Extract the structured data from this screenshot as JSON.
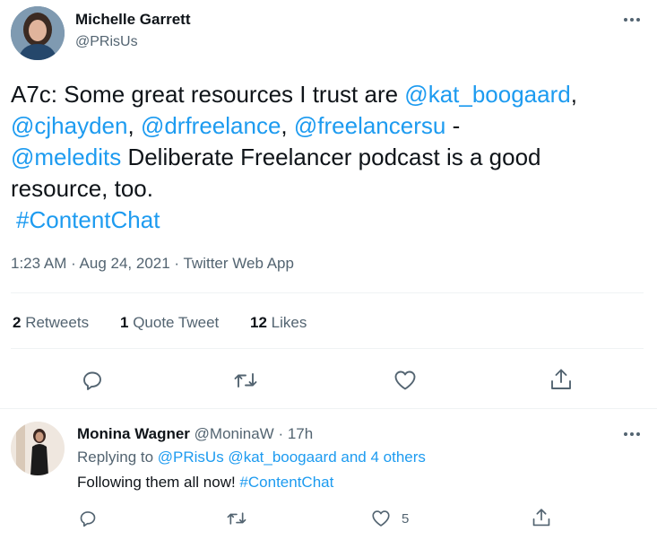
{
  "main_tweet": {
    "author_name": "Michelle Garrett",
    "author_handle": "@PRisUs",
    "text_intro": "A7c: Some great resources I trust are ",
    "mention_1": "@kat_boogaard",
    "sep_1": ",",
    "mention_2": "@cjhayden",
    "sep_2": ", ",
    "mention_3": "@drfreelance",
    "sep_3": ", ",
    "mention_4": "@freelancersu",
    "sep_4": " -",
    "mention_5": "@meledits",
    "text_body": " Deliberate Freelancer podcast is a good resource, too.",
    "hashtag": "#ContentChat",
    "timestamp": "1:23 AM · Aug 24, 2021 · Twitter Web App",
    "retweets_count": "2",
    "retweets_label": "Retweets",
    "quotes_count": "1",
    "quotes_label": "Quote Tweet",
    "likes_count": "12",
    "likes_label": "Likes",
    "more_icon": "more-horizontal-icon"
  },
  "reply_tweet": {
    "author_name": "Monina Wagner",
    "author_handle": "@MoninaW",
    "time_ago": "· 17h",
    "replying_prefix": "Replying to ",
    "replying_targets": "@PRisUs @kat_boogaard and 4 others",
    "text": "Following them all now! ",
    "hashtag": "#ContentChat",
    "like_count": "5"
  },
  "colors": {
    "accent": "#1d9bf0",
    "text": "#0f1419",
    "muted": "#536471"
  }
}
